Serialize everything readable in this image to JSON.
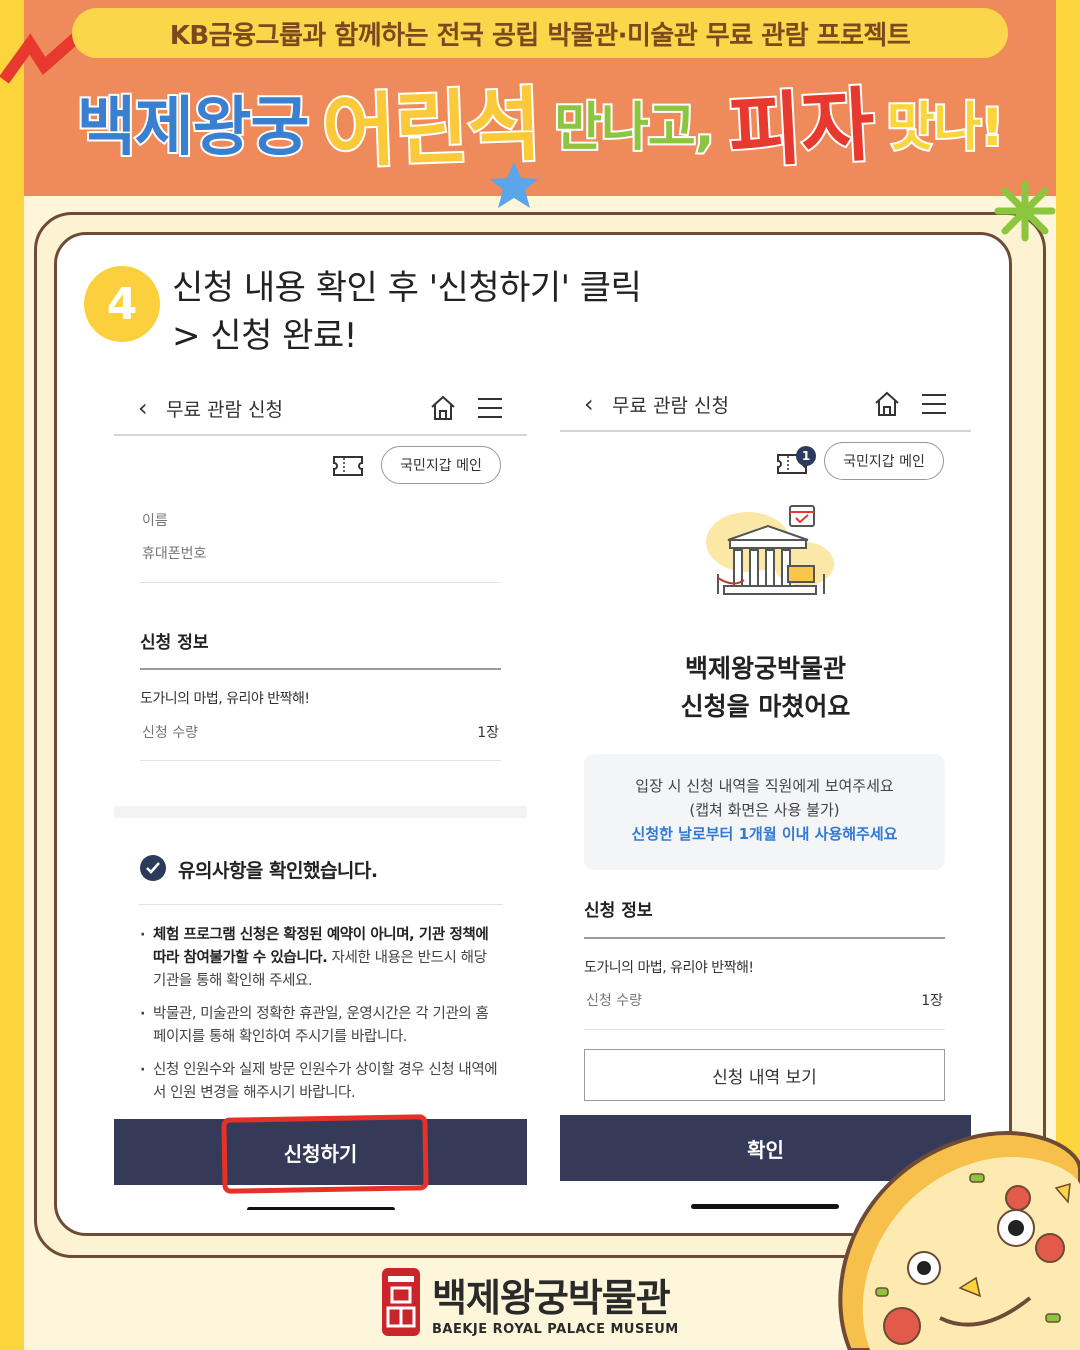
{
  "header": {
    "banner": "KB금융그룹과 함께하는 전국 공립 박물관·미술관 무료 관람 프로젝트",
    "headline_parts": [
      "백제왕궁",
      "어린석",
      "만나고,",
      "피자",
      "맛나!"
    ]
  },
  "step": {
    "number": "4",
    "title_line1": "신청 내용 확인 후 '신청하기' 클릭",
    "title_line2": "> 신청 완료!"
  },
  "left_screen": {
    "nav_title": "무료 관람 신청",
    "wallet_button": "국민지갑 메인",
    "name_label": "이름",
    "phone_label": "휴대폰번호",
    "section_title": "신청 정보",
    "program_name": "도가니의 마법, 유리야 반짝해!",
    "qty_label": "신청 수량",
    "qty_value": "1장",
    "notice_confirmed": "유의사항을 확인했습니다.",
    "bullet1_bold": "체험 프로그램 신청은 확정된 예약이 아니며, 기관 정책에 따라 참여불가할 수 있습니다.",
    "bullet1_rest": " 자세한 내용은 반드시 해당 기관을 통해 확인해 주세요.",
    "bullet2": "박물관, 미술관의 정확한 휴관일, 운영시간은 각 기관의 홈페이지를 통해 확인하여 주시기를 바랍니다.",
    "bullet3": "신청 인원수와 실제 방문 인원수가 상이할 경우 신청 내역에서 인원 변경을 해주시기 바랍니다.",
    "submit_button": "신청하기"
  },
  "right_screen": {
    "nav_title": "무료 관람 신청",
    "ticket_badge": "1",
    "wallet_button": "국민지갑 메인",
    "done_line1": "백제왕궁박물관",
    "done_line2": "신청을 마쳤어요",
    "info_line1": "입장 시 신청 내역을 직원에게 보여주세요",
    "info_line2": "(캡쳐 화면은 사용 불가)",
    "info_line3": "신청한 날로부터 1개월 이내 사용해주세요",
    "section_title": "신청 정보",
    "program_name": "도가니의 마법, 유리야 반짝해!",
    "qty_label": "신청 수량",
    "qty_value": "1장",
    "history_button": "신청 내역 보기",
    "confirm_button": "확인"
  },
  "footer": {
    "museum_name": "백제왕궁박물관",
    "museum_name_en": "BAEKJE ROYAL PALACE MUSEUM"
  },
  "colors": {
    "header_bg": "#ef8a5a",
    "frame": "#fcd43b",
    "navy_button": "#353a58",
    "accent_blue": "#2e7ad6",
    "annotation_red": "#e53127"
  },
  "icons": [
    "back-chevron-icon",
    "home-icon",
    "hamburger-menu-icon",
    "ticket-icon",
    "check-circle-icon",
    "museum-illustration",
    "pizza-illustration"
  ]
}
